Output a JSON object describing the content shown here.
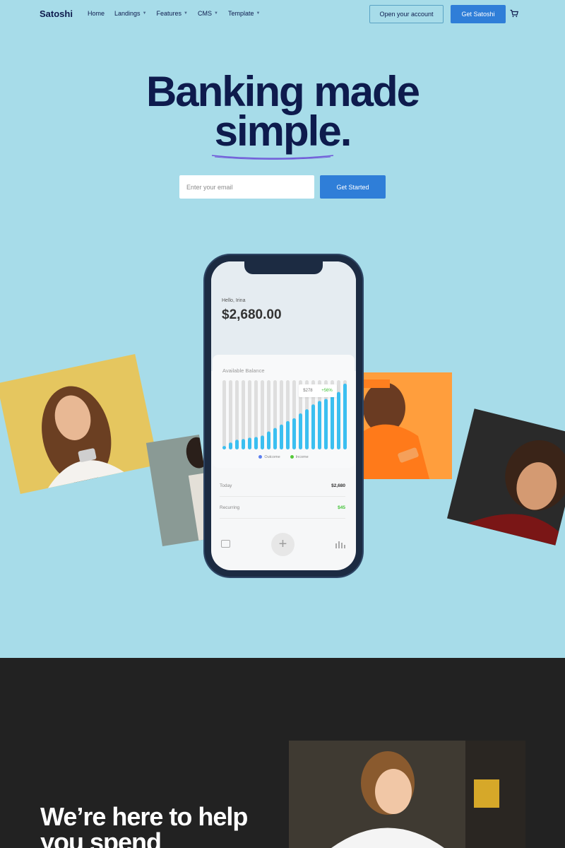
{
  "nav": {
    "brand": "Satoshi",
    "items": [
      {
        "label": "Home",
        "dropdown": false
      },
      {
        "label": "Landings",
        "dropdown": true
      },
      {
        "label": "Features",
        "dropdown": true
      },
      {
        "label": "CMS",
        "dropdown": true
      },
      {
        "label": "Template",
        "dropdown": true
      }
    ],
    "open_account": "Open your account",
    "get_satoshi": "Get Satoshi",
    "cart_icon": "cart-icon"
  },
  "hero": {
    "title_line1": "Banking made",
    "title_line2": "simple.",
    "email_placeholder": "Enter your email",
    "cta": "Get Started"
  },
  "phone": {
    "greeting": "Hello, Irina",
    "balance": "$2,680.00",
    "card_label": "Available Balance",
    "tooltip_value": "$278",
    "tooltip_change": "+56%",
    "legend_outcome": "Outcome",
    "legend_income": "Income",
    "rows": [
      {
        "label": "Today",
        "value": "$2,680"
      },
      {
        "label": "Recurring",
        "value": "$45"
      }
    ],
    "bars": [
      0.05,
      0.1,
      0.14,
      0.15,
      0.17,
      0.18,
      0.2,
      0.26,
      0.31,
      0.36,
      0.41,
      0.45,
      0.52,
      0.58,
      0.65,
      0.7,
      0.73,
      0.77,
      0.83,
      0.95
    ]
  },
  "section2": {
    "title": "We’re here to help you spend"
  },
  "colors": {
    "hero_bg": "#a7dce9",
    "navy": "#0e1b4d",
    "accent": "#2f7ed8",
    "bar_income": "#3bbff0",
    "green": "#45c33a",
    "dark_bg": "#222222"
  }
}
